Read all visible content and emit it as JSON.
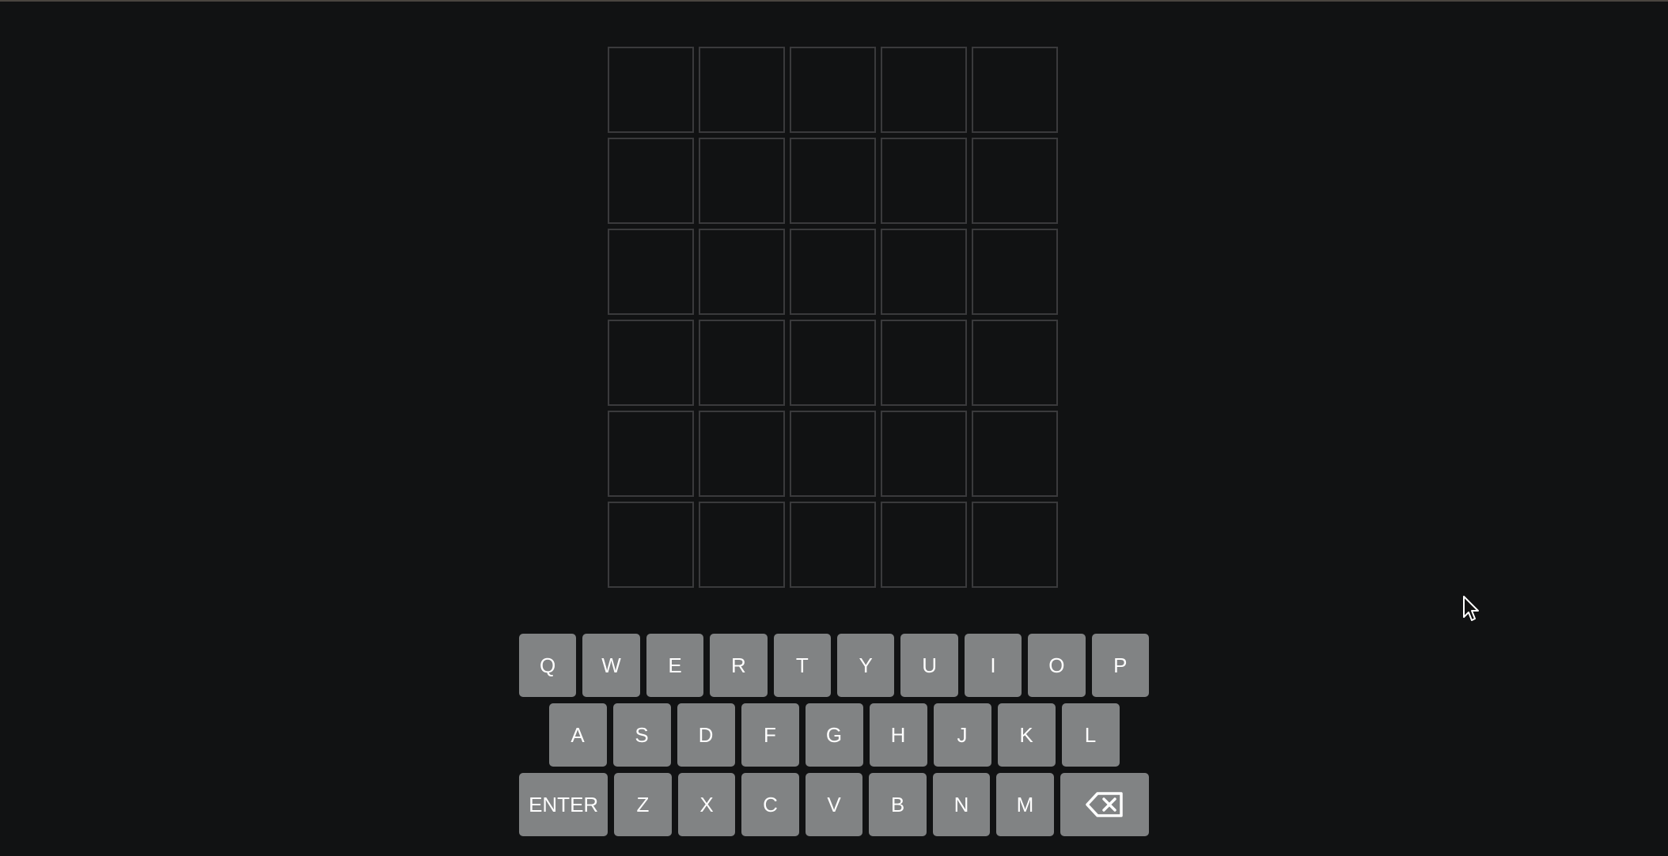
{
  "board": {
    "rows": [
      [
        "",
        "",
        "",
        "",
        ""
      ],
      [
        "",
        "",
        "",
        "",
        ""
      ],
      [
        "",
        "",
        "",
        "",
        ""
      ],
      [
        "",
        "",
        "",
        "",
        ""
      ],
      [
        "",
        "",
        "",
        "",
        ""
      ],
      [
        "",
        "",
        "",
        "",
        ""
      ]
    ]
  },
  "keyboard": {
    "row1": [
      "Q",
      "W",
      "E",
      "R",
      "T",
      "Y",
      "U",
      "I",
      "O",
      "P"
    ],
    "row2": [
      "A",
      "S",
      "D",
      "F",
      "G",
      "H",
      "J",
      "K",
      "L"
    ],
    "row3": [
      "ENTER",
      "Z",
      "X",
      "C",
      "V",
      "B",
      "N",
      "M"
    ],
    "backspace_icon": "backspace-icon"
  },
  "colors": {
    "background": "#111213",
    "tile_border": "#3a3a3c",
    "key": "#818384",
    "key_text": "#ffffff"
  }
}
